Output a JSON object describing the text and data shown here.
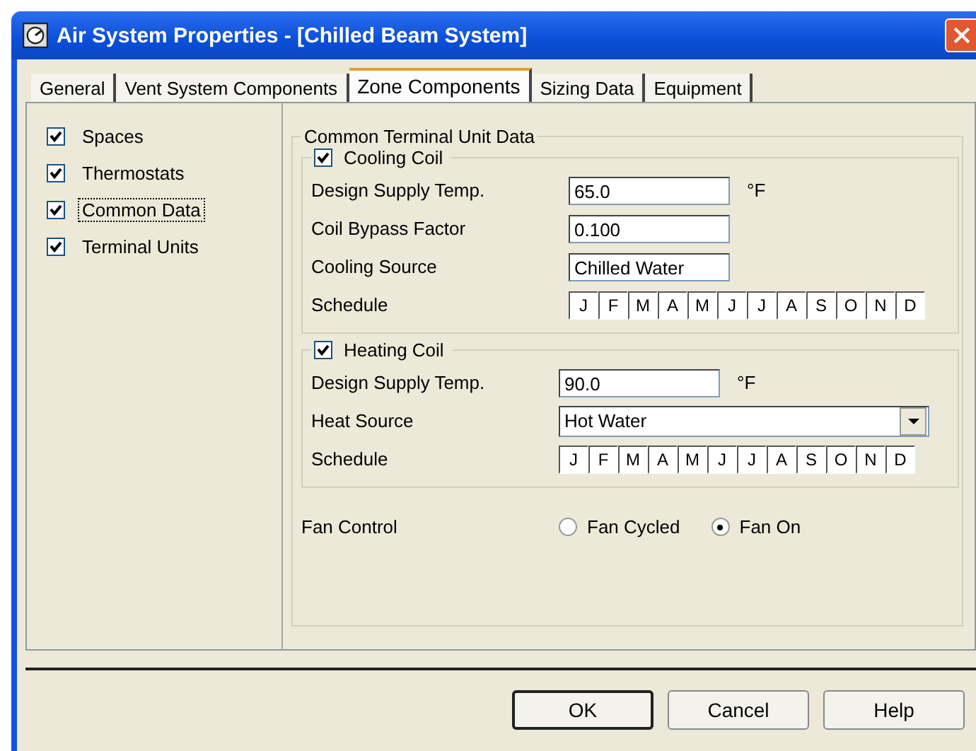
{
  "window": {
    "title": "Air System Properties - [Chilled Beam System]"
  },
  "tabs": [
    {
      "label": "General",
      "selected": false
    },
    {
      "label": "Vent System Components",
      "selected": false
    },
    {
      "label": "Zone Components",
      "selected": true
    },
    {
      "label": "Sizing Data",
      "selected": false
    },
    {
      "label": "Equipment",
      "selected": false
    }
  ],
  "components": [
    {
      "label": "Spaces",
      "checked": true,
      "selected": false
    },
    {
      "label": "Thermostats",
      "checked": true,
      "selected": false
    },
    {
      "label": "Common Data",
      "checked": true,
      "selected": true
    },
    {
      "label": "Terminal Units",
      "checked": true,
      "selected": false
    }
  ],
  "group": {
    "title": "Common Terminal Unit Data"
  },
  "coils": [
    {
      "label": "Cooling Coil",
      "checked": true,
      "fields": [
        {
          "kind": "text",
          "label": "Design Supply Temp.",
          "value": "65.0",
          "unit": "°F"
        },
        {
          "kind": "text",
          "label": "Coil Bypass Factor",
          "value": "0.100"
        },
        {
          "kind": "text",
          "label": "Cooling Source",
          "value": "Chilled Water"
        },
        {
          "kind": "schedule",
          "label": "Schedule",
          "months": [
            "J",
            "F",
            "M",
            "A",
            "M",
            "J",
            "J",
            "A",
            "S",
            "O",
            "N",
            "D"
          ]
        }
      ]
    },
    {
      "label": "Heating Coil",
      "checked": true,
      "fields": [
        {
          "kind": "text",
          "label": "Design Supply Temp.",
          "value": "90.0",
          "unit": "°F"
        },
        {
          "kind": "combo",
          "label": "Heat Source",
          "value": "Hot Water"
        },
        {
          "kind": "schedule",
          "label": "Schedule",
          "months": [
            "J",
            "F",
            "M",
            "A",
            "M",
            "J",
            "J",
            "A",
            "S",
            "O",
            "N",
            "D"
          ]
        }
      ]
    }
  ],
  "fan_control": {
    "label": "Fan Control",
    "options": [
      {
        "label": "Fan Cycled",
        "selected": false
      },
      {
        "label": "Fan On",
        "selected": true
      }
    ]
  },
  "buttons": [
    {
      "label": "OK",
      "default": true
    },
    {
      "label": "Cancel",
      "default": false
    },
    {
      "label": "Help",
      "default": false
    }
  ]
}
